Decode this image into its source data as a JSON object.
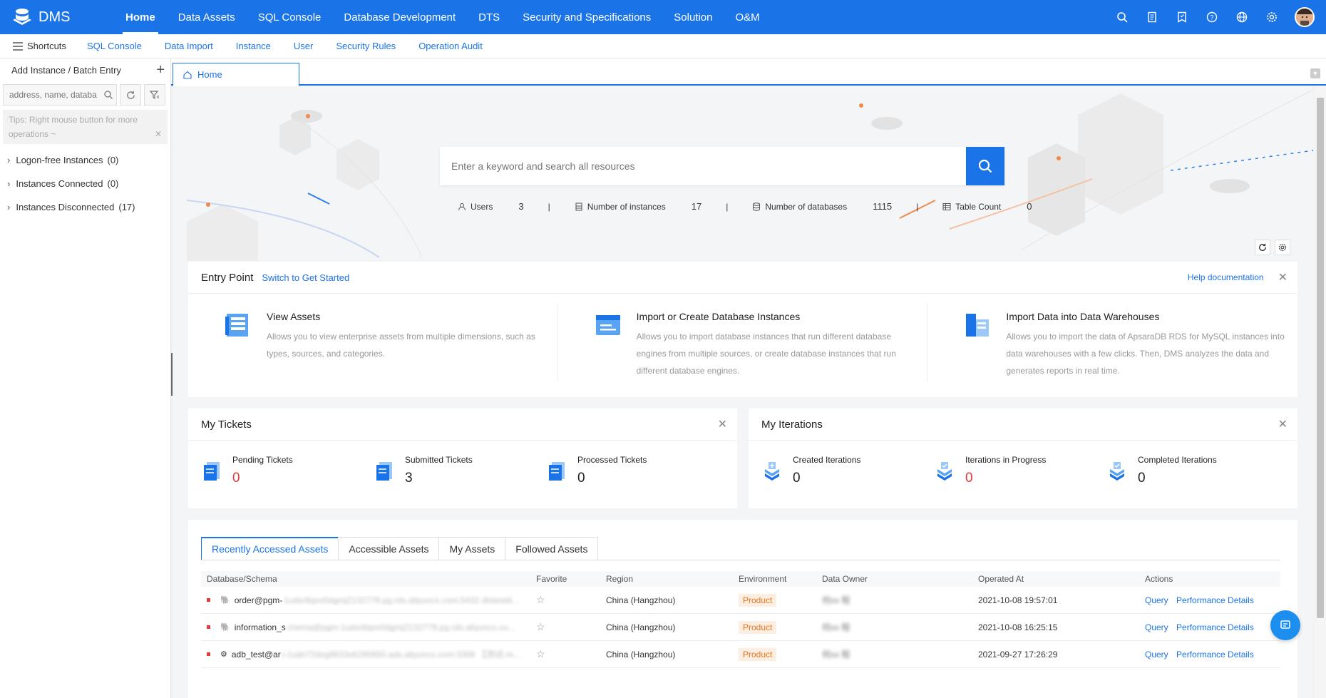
{
  "app": {
    "name": "DMS"
  },
  "nav": {
    "items": [
      {
        "label": "Home",
        "active": true
      },
      {
        "label": "Data Assets"
      },
      {
        "label": "SQL Console"
      },
      {
        "label": "Database Development"
      },
      {
        "label": "DTS"
      },
      {
        "label": "Security and Specifications"
      },
      {
        "label": "Solution"
      },
      {
        "label": "O&M"
      }
    ]
  },
  "topicons": [
    "search-icon",
    "document-icon",
    "bookmark-icon",
    "help-icon",
    "globe-icon",
    "gear-icon"
  ],
  "shortcuts": {
    "label": "Shortcuts",
    "links": [
      "SQL Console",
      "Data Import",
      "Instance",
      "User",
      "Security Rules",
      "Operation Audit"
    ]
  },
  "sidebar": {
    "add_label": "Add Instance / Batch Entry",
    "search_placeholder": "address, name, databa",
    "tip": "Tips: Right mouse button for more operations ~",
    "tree": [
      {
        "label": "Logon-free Instances",
        "count": "(0)"
      },
      {
        "label": "Instances Connected",
        "count": "(0)"
      },
      {
        "label": "Instances Disconnected",
        "count": "(17)"
      }
    ]
  },
  "tabs": {
    "home": "Home"
  },
  "hero": {
    "search_placeholder": "Enter a keyword and search all resources",
    "stats": [
      {
        "label": "Users",
        "value": "3"
      },
      {
        "label": "Number of instances",
        "value": "17"
      },
      {
        "label": "Number of databases",
        "value": "1115"
      },
      {
        "label": "Table Count",
        "value": "0"
      }
    ]
  },
  "entry": {
    "title": "Entry Point",
    "switch": "Switch to Get Started",
    "help": "Help documentation",
    "items": [
      {
        "title": "View Assets",
        "desc": "Allows you to view enterprise assets from multiple dimensions, such as types, sources, and categories."
      },
      {
        "title": "Import or Create Database Instances",
        "desc": "Allows you to import database instances that run different database engines from multiple sources, or create database instances that run different database engines."
      },
      {
        "title": "Import Data into Data Warehouses",
        "desc": "Allows you to import the data of ApsaraDB RDS for MySQL instances into data warehouses with a few clicks. Then, DMS analyzes the data and generates reports in real time."
      }
    ]
  },
  "tickets": {
    "title": "My Tickets",
    "items": [
      {
        "label": "Pending Tickets",
        "value": "0",
        "color": "#e53935"
      },
      {
        "label": "Submitted Tickets",
        "value": "3"
      },
      {
        "label": "Processed Tickets",
        "value": "0"
      }
    ]
  },
  "iterations": {
    "title": "My Iterations",
    "items": [
      {
        "label": "Created Iterations",
        "value": "0"
      },
      {
        "label": "Iterations in Progress",
        "value": "0",
        "color": "#e53935"
      },
      {
        "label": "Completed Iterations",
        "value": "0"
      }
    ]
  },
  "assets": {
    "tabs": [
      "Recently Accessed Assets",
      "Accessible Assets",
      "My Assets",
      "Followed Assets"
    ],
    "columns": [
      "Database/Schema",
      "Favorite",
      "Region",
      "Environment",
      "Data Owner",
      "Operated At",
      "Actions"
    ],
    "rows": [
      {
        "db": "order@pgm-",
        "db_blur": "1udsr8qvv0dgmj2132779.pg.rds.aliyuncs.com:5432 dtstestd...",
        "region": "China (Hangzhou)",
        "env": "Product",
        "owner": "何xx 程",
        "time": "2021-10-08 19:57:01"
      },
      {
        "db": "information_s",
        "db_blur": "chema@pgm-1udsr8qvv0dgmj2132779.pg.rds.aliyuncs.co...",
        "region": "China (Hangzhou)",
        "env": "Product",
        "owner": "何xx 程",
        "time": "2021-10-08 16:25:15"
      },
      {
        "db": "adb_test@ar",
        "db_blur": "i-1udn72dvg8633x6290650.ads.aliyuncs.com:3306 【测试-m...",
        "region": "China (Hangzhou)",
        "env": "Product",
        "owner": "何xx 程",
        "time": "2021-09-27 17:26:29"
      }
    ],
    "actions": [
      "Query",
      "Performance Details"
    ]
  }
}
